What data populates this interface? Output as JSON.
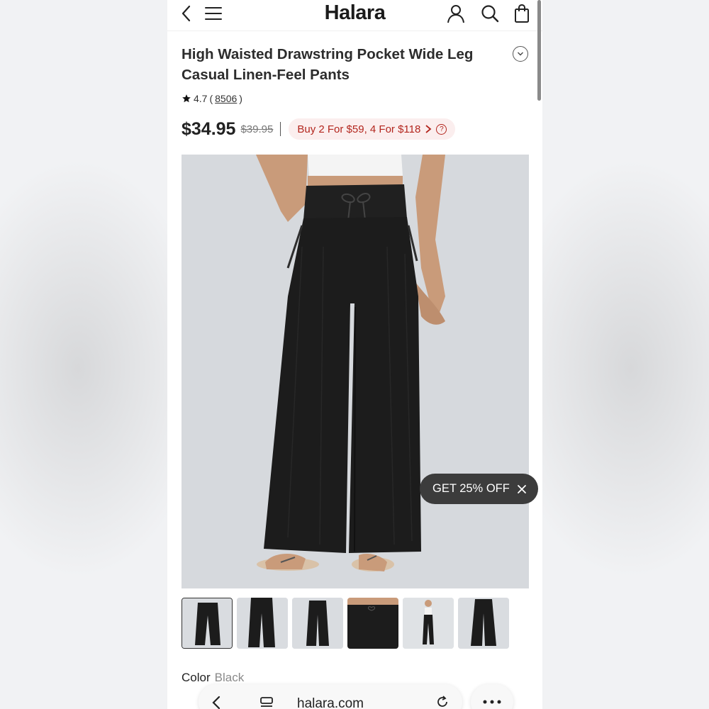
{
  "header": {
    "brand": "Halara",
    "icons": [
      "back-icon",
      "menu-icon",
      "account-icon",
      "search-icon",
      "bag-icon"
    ]
  },
  "product": {
    "title": "High Waisted Drawstring Pocket Wide Leg Casual Linen-Feel Pants",
    "rating": "4.7",
    "review_open": "(",
    "review_count": "8506",
    "review_close": ")",
    "price": "$34.95",
    "original_price": "$39.95",
    "promo": "Buy 2 For $59, 4 For $118",
    "promo_help": "?",
    "color_label": "Color",
    "color_value": "Black"
  },
  "offer": {
    "label": "GET 25% OFF"
  },
  "browser": {
    "url": "halara.com"
  },
  "colors": {
    "promo_text": "#b3261e",
    "promo_bg": "#fbeeee",
    "pants": "#1c1c1c",
    "image_bg": "#d6d9dd"
  }
}
